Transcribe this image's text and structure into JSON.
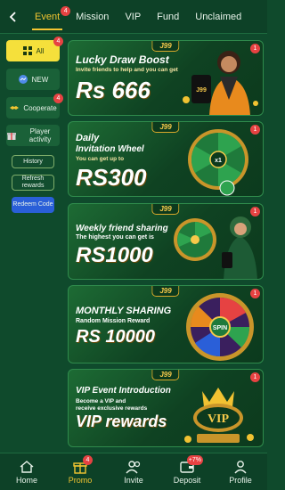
{
  "top_tabs": [
    {
      "label": "Event",
      "badge": "4"
    },
    {
      "label": "Mission"
    },
    {
      "label": "VIP"
    },
    {
      "label": "Fund"
    },
    {
      "label": "Unclaimed"
    }
  ],
  "sidebar": {
    "categories": [
      {
        "label": "All",
        "badge": "4"
      },
      {
        "label": "NEW"
      },
      {
        "label": "Cooperate",
        "badge": "4"
      },
      {
        "label": "Player activity"
      }
    ],
    "actions": [
      {
        "label": "History"
      },
      {
        "label": "Refresh rewards"
      },
      {
        "label": "Redeem Code"
      }
    ]
  },
  "banners": [
    {
      "logo": "J99",
      "title": "Lucky Draw Boost",
      "subtitle": "Invite friends to help and you can get",
      "amount": "Rs 666",
      "badge": "1"
    },
    {
      "logo": "J99",
      "title_line1": "Daily",
      "title_line2": "Invitation Wheel",
      "subtitle": "You can get up to",
      "amount": "RS300",
      "wheel_text": "x1",
      "badge": "1"
    },
    {
      "logo": "J99",
      "title": "Weekly friend sharing",
      "subtitle": "The highest you can get is",
      "amount": "RS1000",
      "badge": "1"
    },
    {
      "logo": "J99",
      "title": "MONTHLY SHARING",
      "subtitle": "Random Mission Reward",
      "amount": "RS 10000",
      "wheel_text": "SPIN",
      "badge": "1"
    },
    {
      "logo": "J99",
      "title": "VIP Event Introduction",
      "subtitle_line1": "Become a VIP and",
      "subtitle_line2": "receive exclusive rewards",
      "amount": "VIP rewards",
      "emblem": "VIP",
      "badge": "1"
    }
  ],
  "bottom_nav": [
    {
      "label": "Home",
      "icon": "home-icon"
    },
    {
      "label": "Promo",
      "icon": "gift-icon",
      "badge": "4"
    },
    {
      "label": "Invite",
      "icon": "users-icon"
    },
    {
      "label": "Deposit",
      "icon": "wallet-icon",
      "badge": "+7%"
    },
    {
      "label": "Profile",
      "icon": "profile-icon"
    }
  ],
  "colors": {
    "accent": "#f3c531",
    "background": "#0f4a2c",
    "badge": "#e64242",
    "active_category": "#f5e03b"
  }
}
